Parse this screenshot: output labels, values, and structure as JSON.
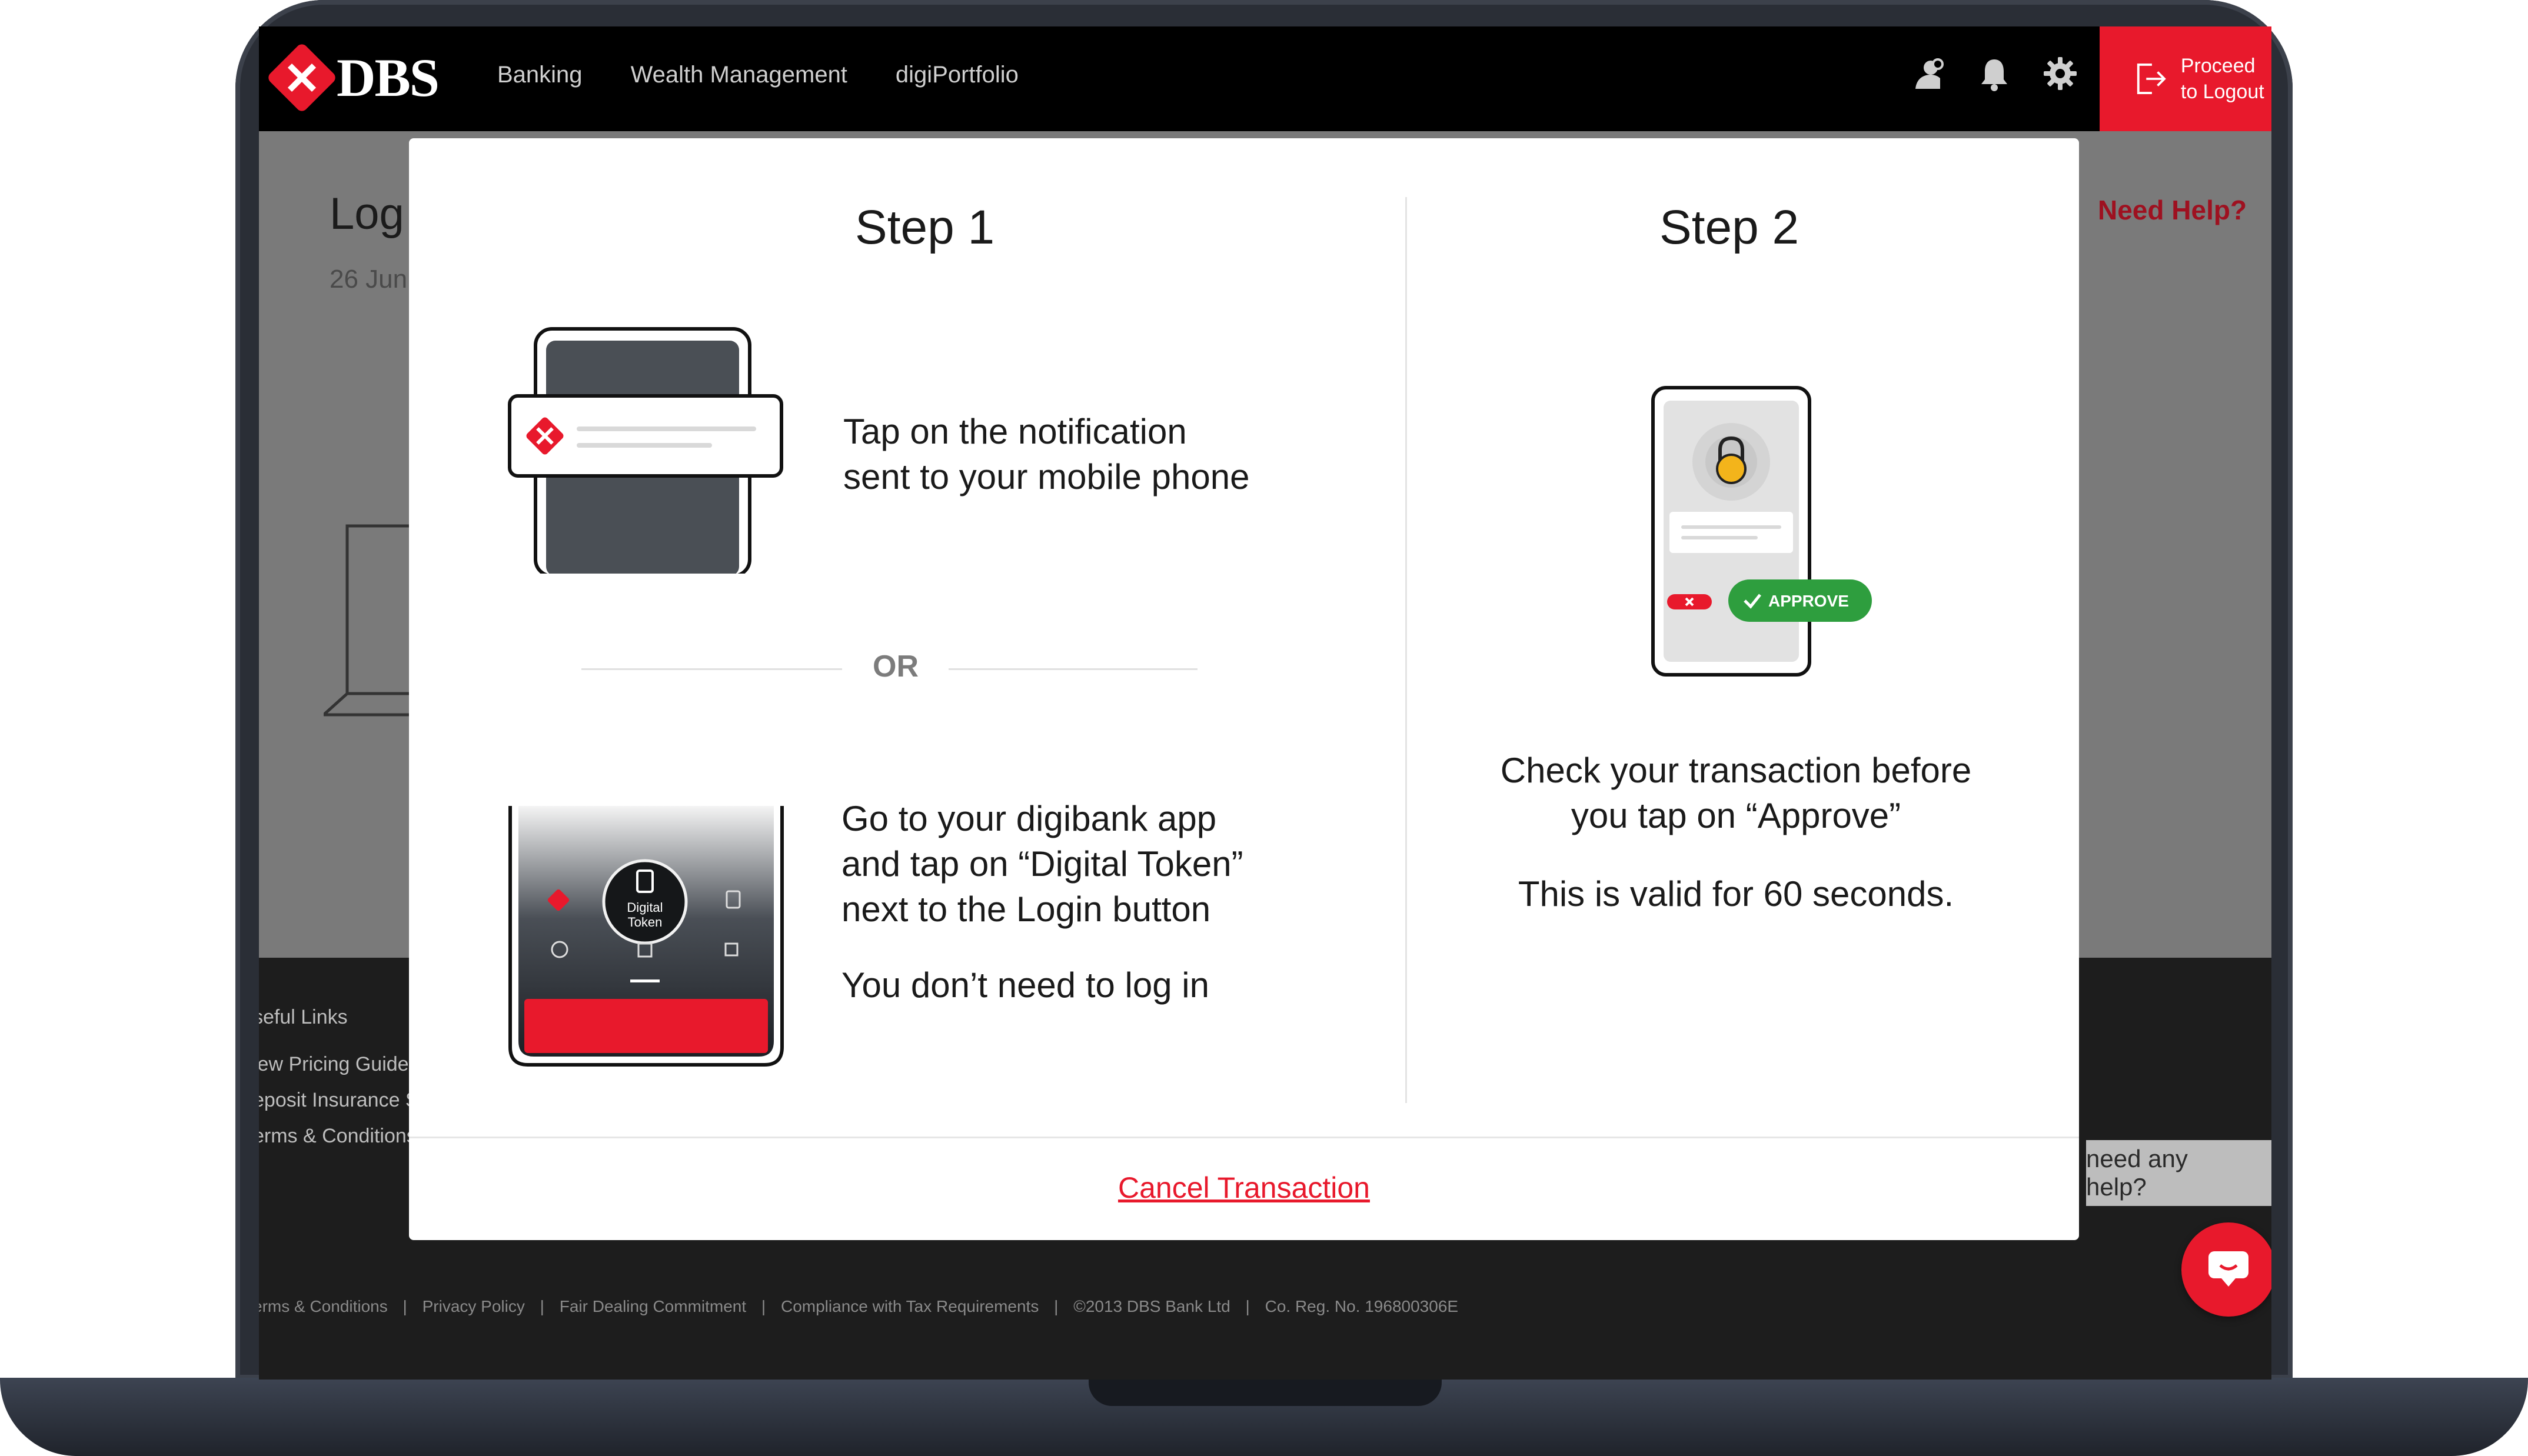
{
  "brand": {
    "name": "DBS"
  },
  "nav": {
    "items": [
      "Banking",
      "Wealth Management",
      "digiPortfolio"
    ]
  },
  "header_icons": [
    "user-support-icon",
    "bell-icon",
    "gear-icon"
  ],
  "logout": {
    "label": "Proceed to Logout"
  },
  "page": {
    "title": "Log",
    "date": "26 Jun",
    "need_help": "Need Help?"
  },
  "footer": {
    "useful_title": "seful Links",
    "links": [
      "iew Pricing Guide",
      "eposit Insurance S",
      "erms & Conditions"
    ],
    "legal": [
      "erms & Conditions",
      "|",
      "Privacy Policy",
      "|",
      "Fair Dealing Commitment",
      "|",
      "Compliance with Tax Requirements",
      "|",
      "©2013 DBS Bank Ltd",
      "|",
      "Co. Reg. No. 196800306E"
    ]
  },
  "help_bubble": "need any help?",
  "modal": {
    "step1": {
      "title": "Step 1",
      "option_a": [
        "Tap on the notification",
        "sent to your mobile phone"
      ],
      "or": "OR",
      "option_b": [
        "Go to your digibank app",
        "and tap on “Digital Token”",
        "next to the Login button"
      ],
      "option_b_sub": "You don’t need to log in",
      "token_label": [
        "Digital",
        "Token"
      ]
    },
    "step2": {
      "title": "Step 2",
      "approve_label": "APPROVE",
      "text": [
        "Check your transaction before",
        "you tap on “Approve”"
      ],
      "sub": "This is valid for 60 seconds."
    },
    "cancel": "Cancel Transaction"
  },
  "colors": {
    "brand_red": "#e8192c",
    "approve_green": "#2e9e3e"
  }
}
